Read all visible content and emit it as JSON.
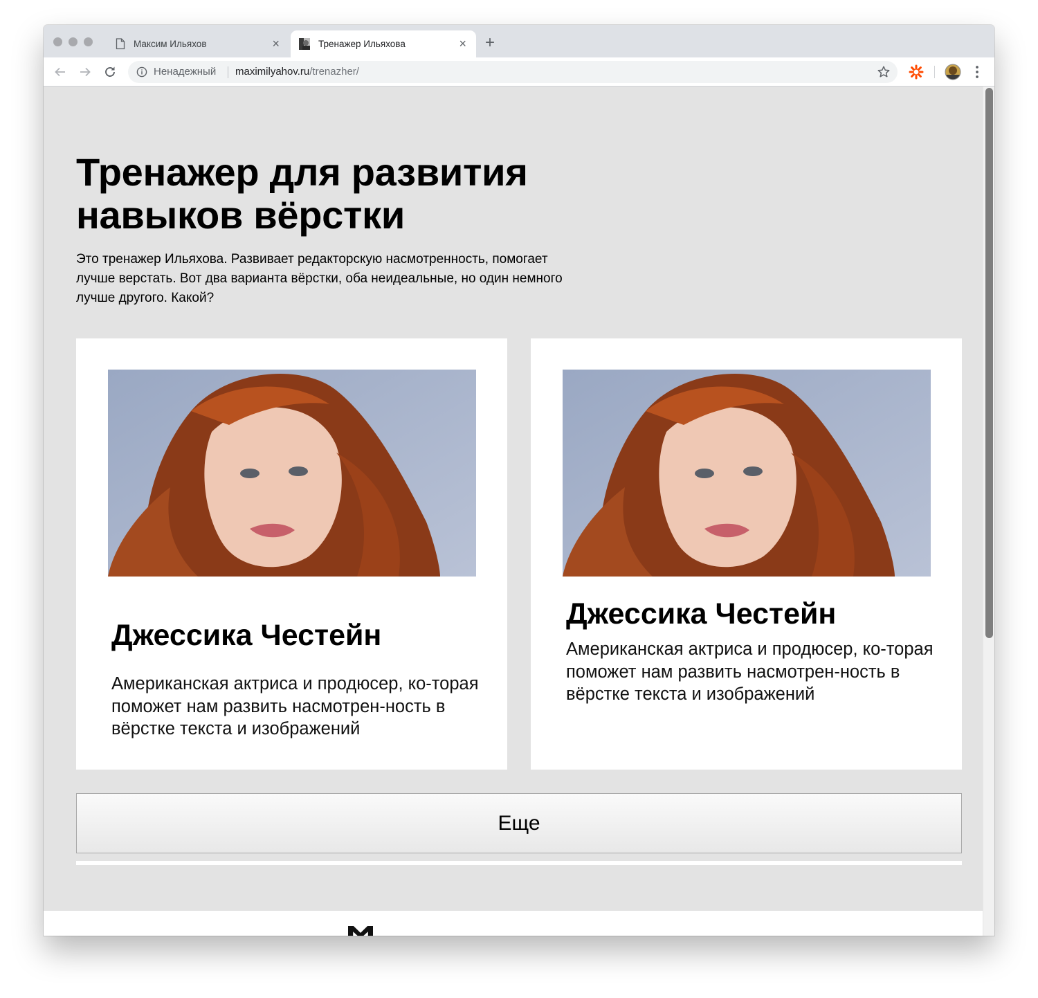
{
  "browser": {
    "tabs": [
      {
        "title": "Максим Ильяхов",
        "active": false
      },
      {
        "title": "Тренажер Ильяхова",
        "active": true
      }
    ],
    "close_glyph": "×",
    "new_tab_glyph": "+",
    "address": {
      "security_label": "Ненадежный",
      "url_host": "maximilyahov.ru",
      "url_path": "/trenazher/"
    },
    "icons": {
      "back": "arrow-left-icon",
      "forward": "arrow-right-icon",
      "reload": "reload-icon",
      "info": "info-icon",
      "bookmark": "star-icon",
      "extension": "asterisk-extension-icon",
      "profile": "avatar",
      "menu": "vertical-dots-icon"
    }
  },
  "page": {
    "title": "Тренажер для развития навыков вёрстки",
    "intro": "Это тренажер Ильяхова. Развивает редакторскую насмотренность, помогает лучше верстать. Вот два варианта вёрстки, оба неидеальные, но один немного лучше другого. Какой?",
    "cards": [
      {
        "name": "Джессика Честейн",
        "description": "Американская актриса и продюсер, ко-торая поможет нам развить насмотрен-ность в вёрстке текста и изображений"
      },
      {
        "name": "Джессика Честейн",
        "description": "Американская актриса и продюсер, ко-торая поможет нам развить насмотрен-ность в вёрстке текста и изображений"
      }
    ],
    "more_button": "Еще"
  },
  "colors": {
    "page_background": "#e3e3e3",
    "card_background": "#ffffff",
    "tab_strip": "#dee1e6",
    "extension_accent": "#ff4a00"
  }
}
